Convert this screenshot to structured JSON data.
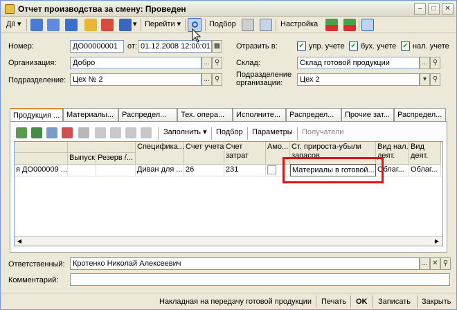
{
  "window": {
    "title": "Отчет производства за смену: Проведен"
  },
  "toolbar": {
    "actions": "Дії",
    "go": "Перейти",
    "selection": "Подбор",
    "settings": "Настройка"
  },
  "header": {
    "number_label": "Номер:",
    "number_value": "ДО00000001",
    "date_label": "от:",
    "date_value": "01.12.2008 12:00:01",
    "org_label": "Организация:",
    "org_value": "Добро",
    "dept_label": "Подразделение:",
    "dept_value": "Цех № 2",
    "reflect_label": "Отразить в:",
    "reflect_mgmt": "упр. учете",
    "reflect_acc": "бух. учете",
    "reflect_tax": "нал. учете",
    "warehouse_label": "Склад:",
    "warehouse_value": "Склад готовой продукции",
    "orgdept_label_1": "Подразделение",
    "orgdept_label_2": "организации:",
    "orgdept_value": "Цех 2"
  },
  "tabs": [
    "Продукция ...",
    "Материалы...",
    "Распредел...",
    "Тех. опера...",
    "Исполните...",
    "Распредел...",
    "Прочие зат...",
    "Распредел..."
  ],
  "subtoolbar": {
    "fill": "Заполнить",
    "selection": "Подбор",
    "parameters": "Параметры",
    "recipients": "Получатели"
  },
  "grid": {
    "headers": {
      "release": "Выпуск",
      "reserve": "Резерв /...",
      "spec": "Специфика...",
      "account": "Счет учета",
      "cost_account_1": "Счет",
      "cost_account_2": "затрат",
      "amort": "Амо...",
      "increase_1": "Ст. прироста-убыли",
      "increase_2": "запасов",
      "tax_type_1": "Вид нал.",
      "tax_type_2": "деят.",
      "tax_act_1": "Вид",
      "tax_act_2": "деят."
    },
    "row": {
      "doc": "я ДО000009 ...",
      "spec": "Диван для ...",
      "account": "26",
      "cost_account": "231",
      "increase": "Материалы в готовой...",
      "tax_type": "Облаг...",
      "tax_act": "Облаг..."
    }
  },
  "footer": {
    "responsible_label": "Ответственный:",
    "responsible_value": "Кротенко Николай Алексеевич",
    "comment_label": "Комментарий:",
    "comment_value": ""
  },
  "bottombar": {
    "invoice": "Накладная на передачу готовой продукции",
    "print": "Печать",
    "ok": "OK",
    "save": "Записать",
    "close": "Закрыть"
  },
  "colors": {
    "highlight": "#e01010",
    "accent": "#e68b2c"
  }
}
